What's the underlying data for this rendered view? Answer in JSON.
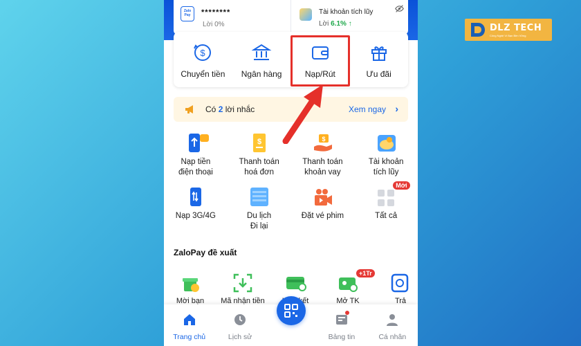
{
  "account": {
    "masked_balance": "********",
    "interest": "Lời 0%",
    "savings_title": "Tài khoản tích lũy",
    "savings_rate_label": "Lời",
    "savings_rate_value": "6.1%",
    "savings_rate_arrow": "↑"
  },
  "quick_actions": [
    {
      "label": "Chuyển tiền",
      "icon": "transfer-icon"
    },
    {
      "label": "Ngân hàng",
      "icon": "bank-icon"
    },
    {
      "label": "Nạp/Rút",
      "icon": "wallet-icon"
    },
    {
      "label": "Ưu đãi",
      "icon": "gift-icon"
    }
  ],
  "reminder": {
    "prefix": "Có",
    "count": "2",
    "suffix": "lời nhắc",
    "link": "Xem ngay"
  },
  "services": [
    {
      "line1": "Nạp tiền",
      "line2": "điện thoại",
      "icon": "phone-topup-icon"
    },
    {
      "line1": "Thanh toán",
      "line2": "hoá đơn",
      "icon": "bill-icon"
    },
    {
      "line1": "Thanh toán",
      "line2": "khoản vay",
      "icon": "loan-icon"
    },
    {
      "line1": "Tài khoản",
      "line2": "tích lũy",
      "icon": "savings-icon"
    },
    {
      "line1": "Nạp 3G/4G",
      "line2": "",
      "icon": "mobile-data-icon"
    },
    {
      "line1": "Du lịch",
      "line2": "Đi lại",
      "icon": "travel-icon"
    },
    {
      "line1": "Đặt vé phim",
      "line2": "",
      "icon": "movie-icon"
    },
    {
      "line1": "Tất cả",
      "line2": "",
      "icon": "grid-icon",
      "badge": "Mới"
    }
  ],
  "section_title": "ZaloPay đề xuất",
  "suggestions": [
    {
      "label": "Mời bạn",
      "icon": "gift-coin-icon"
    },
    {
      "label": "Mã nhận tiền",
      "icon": "qr-receive-icon"
    },
    {
      "label": "Liên kết",
      "icon": "card-link-icon"
    },
    {
      "label": "Mở TK",
      "icon": "open-account-icon",
      "badge": "+1Tr"
    },
    {
      "label": "Trả",
      "icon": "clock-icon"
    }
  ],
  "tabs": [
    {
      "label": "Trang chủ",
      "icon": "home-icon",
      "active": true
    },
    {
      "label": "Lịch sử",
      "icon": "history-icon",
      "active": false
    },
    {
      "label": "",
      "icon": "qr-scan-icon",
      "active": false
    },
    {
      "label": "Bảng tin",
      "icon": "news-icon",
      "active": false
    },
    {
      "label": "Cá nhân",
      "icon": "profile-icon",
      "active": false
    }
  ],
  "brand": {
    "name": "DLZ TECH",
    "tagline": "Công Nghệ Vì Bạn Bền Vững"
  },
  "colors": {
    "primary": "#1b67e6",
    "accent_red": "#e5302a",
    "badge_red": "#e53935",
    "brand_gold": "#f2b541"
  }
}
